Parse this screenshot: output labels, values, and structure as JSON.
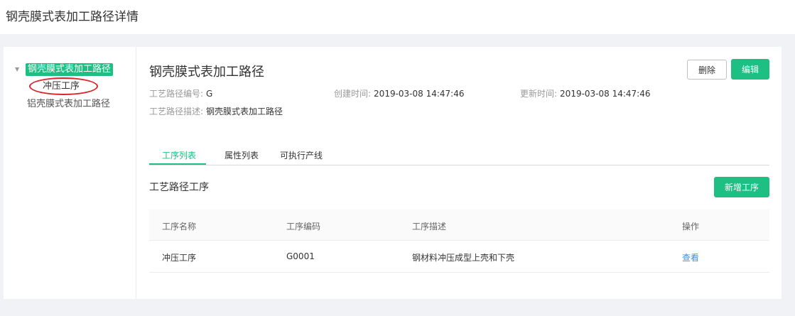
{
  "page": {
    "title": "钢壳膜式表加工路径详情"
  },
  "tree": {
    "root_label": "钢壳膜式表加工路径",
    "child_label": "冲压工序",
    "sibling_label": "铝壳膜式表加工路径"
  },
  "detail": {
    "title": "钢壳膜式表加工路径",
    "delete_label": "删除",
    "edit_label": "编辑",
    "code_label": "工艺路径编号:",
    "code_value": "G",
    "created_label": "创建时间:",
    "created_value": "2019-03-08 14:47:46",
    "updated_label": "更新时间:",
    "updated_value": "2019-03-08 14:47:46",
    "desc_label": "工艺路径描述:",
    "desc_value": "钢壳膜式表加工路径"
  },
  "tabs": [
    {
      "label": "工序列表",
      "active": true
    },
    {
      "label": "属性列表",
      "active": false
    },
    {
      "label": "可执行产线",
      "active": false
    }
  ],
  "section": {
    "title": "工艺路径工序",
    "add_label": "新增工序"
  },
  "table": {
    "headers": [
      "工序名称",
      "工序编码",
      "工序描述",
      "操作"
    ],
    "rows": [
      {
        "name": "冲压工序",
        "code": "G0001",
        "desc": "钢材料冲压成型上壳和下壳",
        "action": "查看"
      }
    ]
  },
  "colors": {
    "accent": "#1dbf82",
    "link": "#3a8ee6",
    "annotation": "#d9262b"
  }
}
